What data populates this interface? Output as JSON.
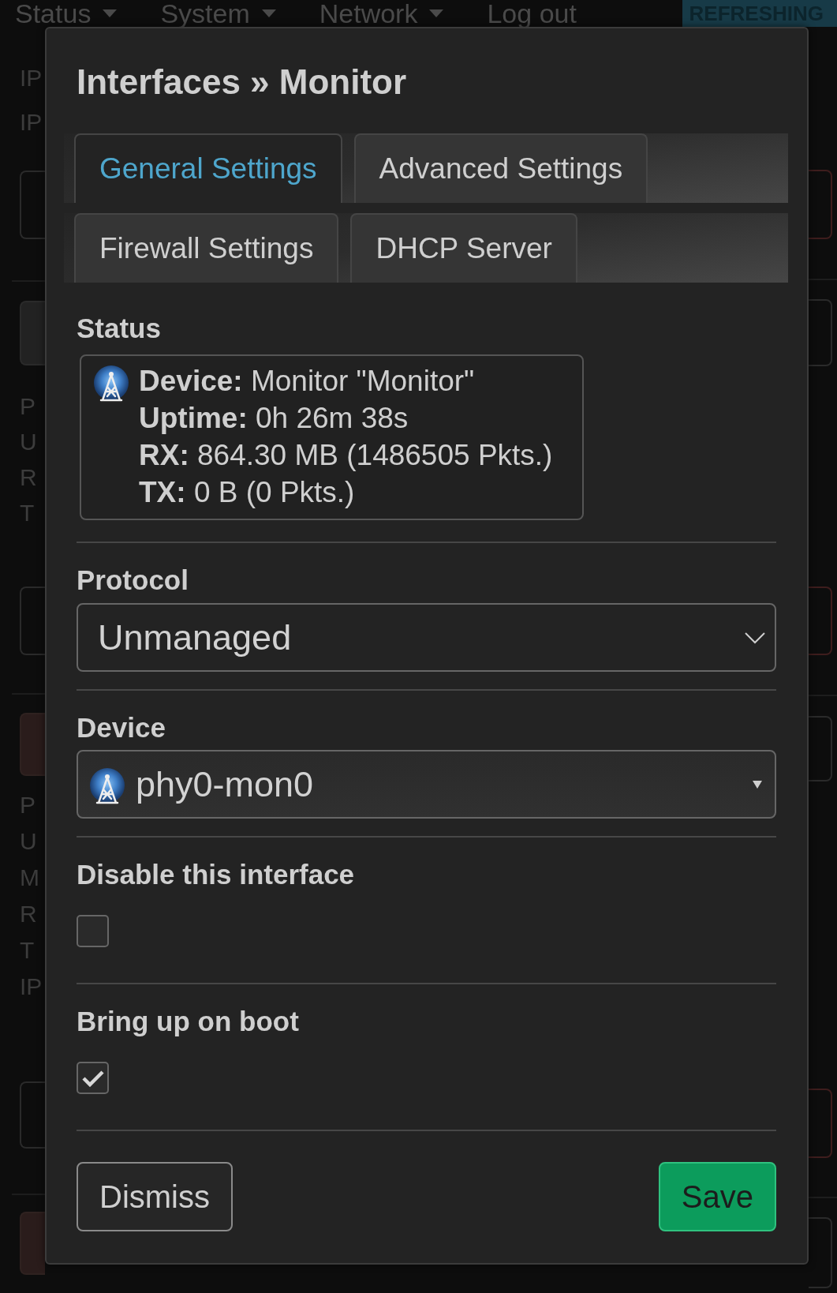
{
  "background_page": {
    "nav": [
      {
        "label": "Status",
        "kind": "menu"
      },
      {
        "label": "System",
        "kind": "menu"
      },
      {
        "label": "Network",
        "kind": "menu"
      },
      {
        "label": "Log out",
        "kind": "link"
      }
    ],
    "badge": "REFRESHING",
    "label_groups": [
      [
        "IP",
        "IP"
      ],
      [
        "P",
        "U",
        "R",
        "T"
      ],
      [
        "P",
        "U",
        "M",
        "R",
        "T",
        "IP"
      ]
    ]
  },
  "dialog": {
    "title": "Interfaces » Monitor",
    "tab_rows": [
      [
        {
          "label": "General Settings",
          "selected": true
        },
        {
          "label": "Advanced Settings",
          "selected": false
        }
      ],
      [
        {
          "label": "Firewall Settings",
          "selected": false
        },
        {
          "label": "DHCP Server",
          "selected": false
        }
      ]
    ],
    "fields": [
      {
        "kind": "status",
        "label": "Status",
        "lines": [
          "**Device:** Monitor \"Monitor\"",
          "**Uptime:** 0h 26m 38s",
          "**RX:** 864.30 MB (1486505 Pkts.)",
          "**TX:** 0 B (0 Pkts.)"
        ]
      },
      {
        "kind": "select",
        "label": "Protocol",
        "value": "Unmanaged"
      },
      {
        "kind": "device_select",
        "label": "Device",
        "value": "phy0-mon0"
      },
      {
        "kind": "checkbox",
        "label": "Disable this interface",
        "checked": false
      },
      {
        "kind": "checkbox",
        "label": "Bring up on boot",
        "checked": true
      }
    ],
    "buttons": [
      {
        "label": "Dismiss",
        "kind": "dismiss"
      },
      {
        "label": "Save",
        "kind": "save"
      }
    ]
  }
}
